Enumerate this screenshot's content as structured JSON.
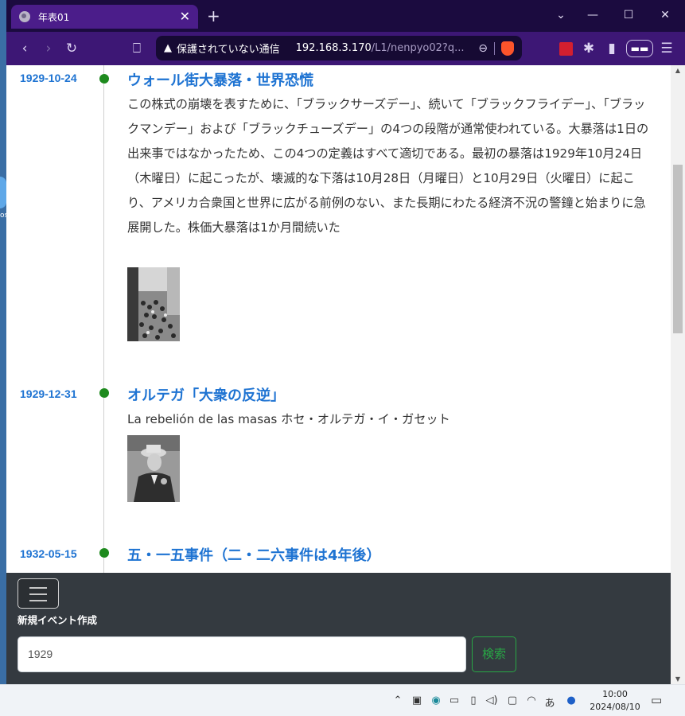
{
  "browser": {
    "tab_title": "年表01",
    "tab_close": "✕",
    "new_tab": "+",
    "dropdown": "⌄",
    "minimize": "—",
    "maximize": "☐",
    "close": "✕",
    "url_warning": "保護されていない通信",
    "url_host": "192.168.3.170",
    "url_path": "/L1/nenpyo02?q...",
    "vpn_label": "▬▬"
  },
  "events": [
    {
      "date": "1929-10-24",
      "title": "ウォール街大暴落・世界恐慌",
      "description": "この株式の崩壊を表すために、「ブラックサーズデー」、続いて「ブラックフライデー」、「ブラックマンデー」および「ブラックチューズデー」の4つの段階が通常使われている。大暴落は1日の出来事ではなかったため、この4つの定義はすべて適切である。最初の暴落は1929年10月24日（木曜日）に起こったが、壊滅的な下落は10月28日（月曜日）と10月29日（火曜日）に起こり、アメリカ合衆国と世界に広がる前例のない、また長期にわたる経済不況の警鐘と始まりに急展開した。株価大暴落は1か月間続いた"
    },
    {
      "date": "1929-12-31",
      "title": "オルテガ「大衆の反逆」",
      "description": "La rebelión de las masas ホセ・オルテガ・イ・ガセット"
    },
    {
      "date": "1932-05-15",
      "title": "五・一五事件（二・二六事件は4年後）",
      "description": ""
    }
  ],
  "bottom_panel": {
    "new_event_label": "新規イベント作成",
    "search_value": "1929",
    "search_button": "検索"
  },
  "taskbar": {
    "time": "10:00",
    "date": "2024/08/10",
    "tray_text": "あ"
  },
  "colors": {
    "accent_blue": "#1e73d2",
    "dot_green": "#1e8a1e",
    "browser_purple": "#3d1775"
  }
}
